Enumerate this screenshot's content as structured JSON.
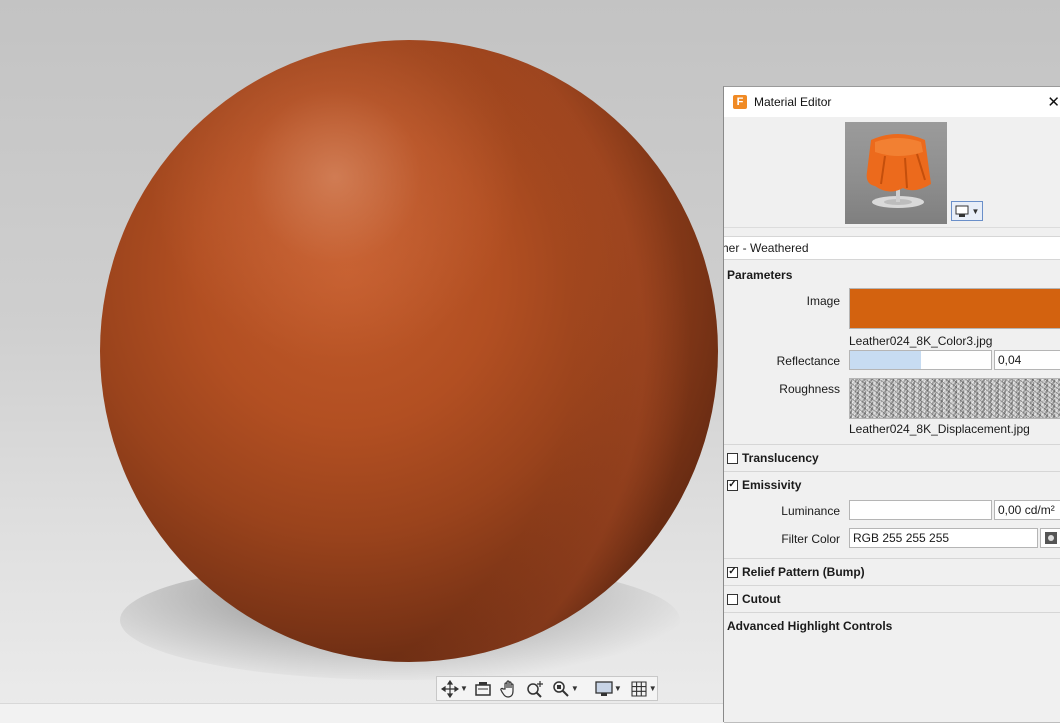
{
  "viewport": {
    "toolbar": [
      {
        "icon": "orbit-icon",
        "has_dropdown": true
      },
      {
        "icon": "camera-icon",
        "has_dropdown": false
      },
      {
        "icon": "pan-hand-icon",
        "has_dropdown": false
      },
      {
        "icon": "zoom-interactive-icon",
        "has_dropdown": false
      },
      {
        "icon": "zoom-extents-icon",
        "has_dropdown": true
      },
      {
        "icon": "display-settings-icon",
        "has_dropdown": true
      },
      {
        "icon": "grid-icon",
        "has_dropdown": true
      }
    ],
    "sphere_color": "#b24f22"
  },
  "material_editor": {
    "title": "Material Editor",
    "app_icon_letter": "F",
    "material_name": "ather - Weathered",
    "parameters_heading": "Parameters",
    "image": {
      "label": "Image",
      "filename": "Leather024_8K_Color3.jpg",
      "color": "#d3620f"
    },
    "reflectance": {
      "label": "Reflectance",
      "value": "0,04",
      "fill_fraction": 0.04
    },
    "roughness": {
      "label": "Roughness",
      "filename": "Leather024_8K_Displacement.jpg"
    },
    "translucency": {
      "label": "Translucency",
      "checked": false
    },
    "emissivity": {
      "label": "Emissivity",
      "checked": true,
      "luminance_label": "Luminance",
      "luminance_value": "0,00 cd/m²",
      "filter_color_label": "Filter Color",
      "filter_color_value": "RGB 255 255 255"
    },
    "relief": {
      "label": "Relief Pattern (Bump)",
      "checked": true
    },
    "cutout": {
      "label": "Cutout",
      "checked": false
    },
    "advanced_heading": "Advanced Highlight Controls"
  }
}
